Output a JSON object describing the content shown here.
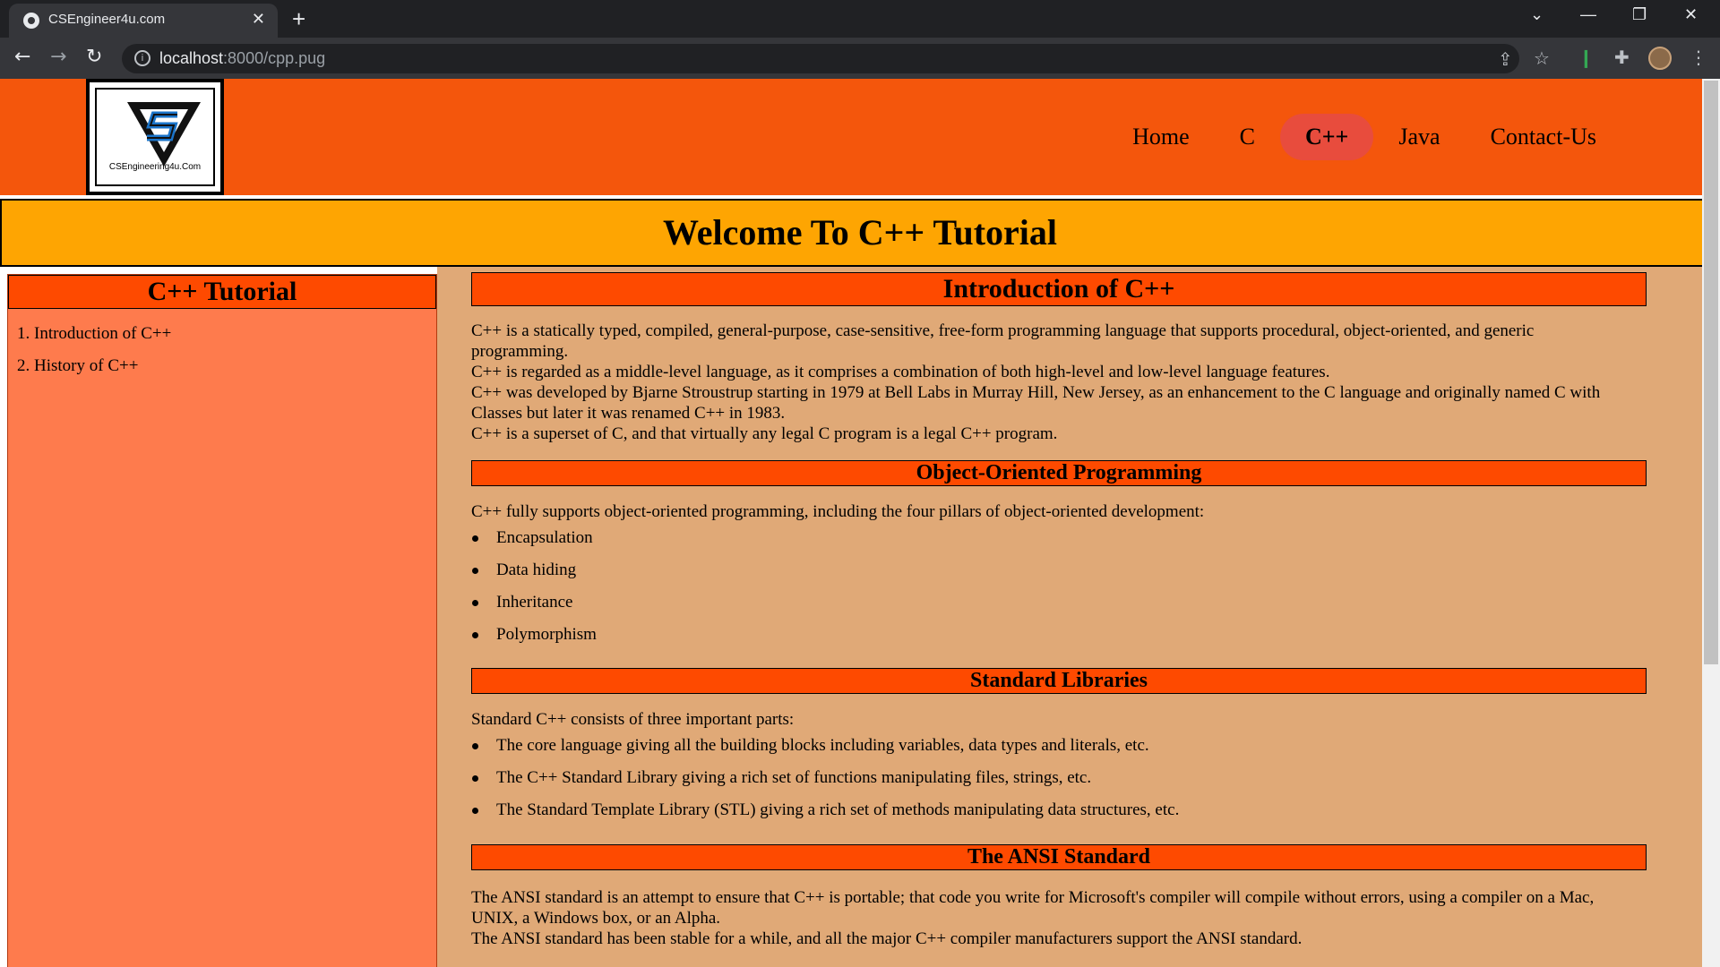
{
  "browser": {
    "tab_title": "CSEngineer4u.com",
    "close_tab": "✕",
    "new_tab": "+",
    "url_host": "localhost",
    "url_path": ":8000/cpp.pug",
    "window_controls": {
      "tablist": "⌄",
      "minimize": "—",
      "restore": "❐",
      "close": "✕"
    }
  },
  "site": {
    "logo_text": "CSEngineering4u.Com",
    "nav": [
      "Home",
      "C",
      "C++",
      "Java",
      "Contact-Us"
    ],
    "active_nav": "C++",
    "banner_title": "Welcome To C++ Tutorial"
  },
  "sidebar": {
    "title": "C++ Tutorial",
    "items": [
      "1. Introduction of C++",
      "2. History of C++"
    ]
  },
  "content": {
    "intro": {
      "heading": "Introduction of C++",
      "lines": [
        "C++ is a statically typed, compiled, general-purpose, case-sensitive, free-form programming language that supports procedural, object-oriented, and generic programming.",
        "C++ is regarded as a middle-level language, as it comprises a combination of both high-level and low-level language features.",
        "C++ was developed by Bjarne Stroustrup starting in 1979 at Bell Labs in Murray Hill, New Jersey, as an enhancement to the C language and originally named C with Classes but later it was renamed C++ in 1983.",
        "C++ is a superset of C, and that virtually any legal C program is a legal C++ program."
      ]
    },
    "oop": {
      "heading": "Object-Oriented Programming",
      "text": "C++ fully supports object-oriented programming, including the four pillars of object-oriented development:",
      "items": [
        "Encapsulation",
        "Data hiding",
        "Inheritance",
        "Polymorphism"
      ]
    },
    "stdlib": {
      "heading": "Standard Libraries",
      "text": "Standard C++ consists of three important parts:",
      "items": [
        "The core language giving all the building blocks including variables, data types and literals, etc.",
        "The C++ Standard Library giving a rich set of functions manipulating files, strings, etc.",
        "The Standard Template Library (STL) giving a rich set of methods manipulating data structures, etc."
      ]
    },
    "ansi": {
      "heading": "The ANSI Standard",
      "lines": [
        "The ANSI standard is an attempt to ensure that C++ is portable; that code you write for Microsoft's compiler will compile without errors, using a compiler on a Mac, UNIX, a Windows box, or an Alpha.",
        "The ANSI standard has been stable for a while, and all the major C++ compiler manufacturers support the ANSI standard."
      ]
    }
  },
  "colors": {
    "header": "#f4560c",
    "banner": "#fea502",
    "sidebar": "#fe7b4d",
    "content": "#e0a977",
    "section_heading": "#fe4a00",
    "active_nav": "#e84c3d"
  }
}
